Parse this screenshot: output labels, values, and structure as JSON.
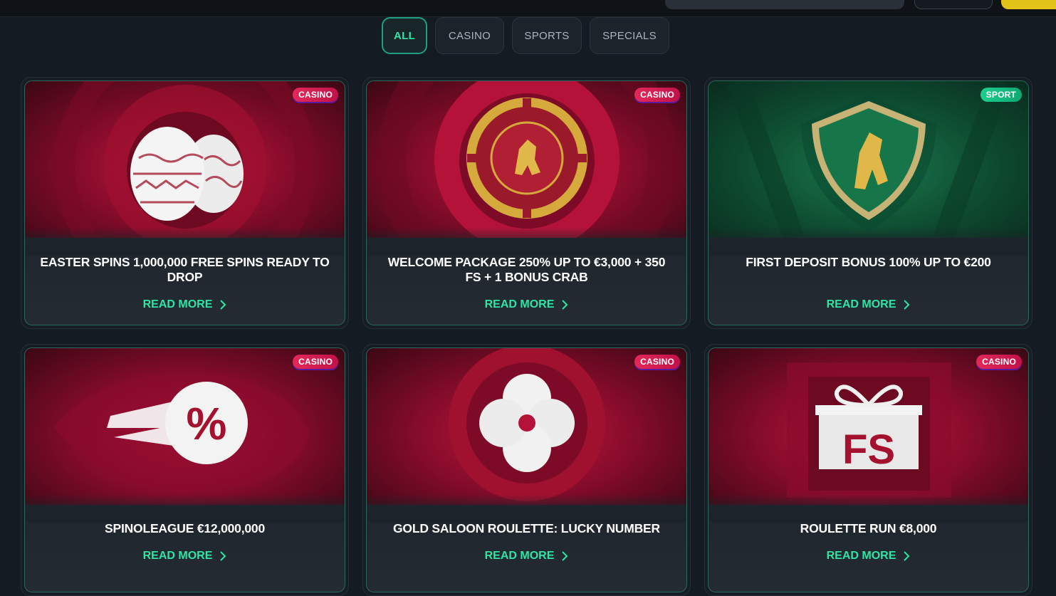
{
  "filters": [
    {
      "label": "ALL",
      "active": true
    },
    {
      "label": "CASINO",
      "active": false
    },
    {
      "label": "SPORTS",
      "active": false
    },
    {
      "label": "SPECIALS",
      "active": false
    }
  ],
  "cards": [
    {
      "title": "EASTER SPINS 1,000,000 FREE SPINS READY TO DROP",
      "badge": "CASINO",
      "cta": "READ MORE",
      "icon": "easter-eggs-icon"
    },
    {
      "title": "WELCOME PACKAGE 250% UP TO €3,000 + 350 FS + 1 BONUS CRAB",
      "badge": "CASINO",
      "cta": "READ MORE",
      "icon": "casino-chip-icon"
    },
    {
      "title": "FIRST DEPOSIT BONUS 100% UP TO €200",
      "badge": "SPORT",
      "cta": "READ MORE",
      "icon": "lion-shield-icon"
    },
    {
      "title": "SPINOLEAGUE €12,000,000",
      "badge": "CASINO",
      "cta": "READ MORE",
      "icon": "percent-comet-icon"
    },
    {
      "title": "GOLD SALOON ROULETTE: LUCKY NUMBER",
      "badge": "CASINO",
      "cta": "READ MORE",
      "icon": "clover-icon"
    },
    {
      "title": "ROULETTE RUN €8,000",
      "badge": "CASINO",
      "cta": "READ MORE",
      "icon": "gift-fs-icon"
    }
  ],
  "colors": {
    "accent": "#2ee6a3",
    "casino_badge": "#e4285a",
    "sport_badge": "#1ccf8c",
    "background": "#151b22"
  }
}
